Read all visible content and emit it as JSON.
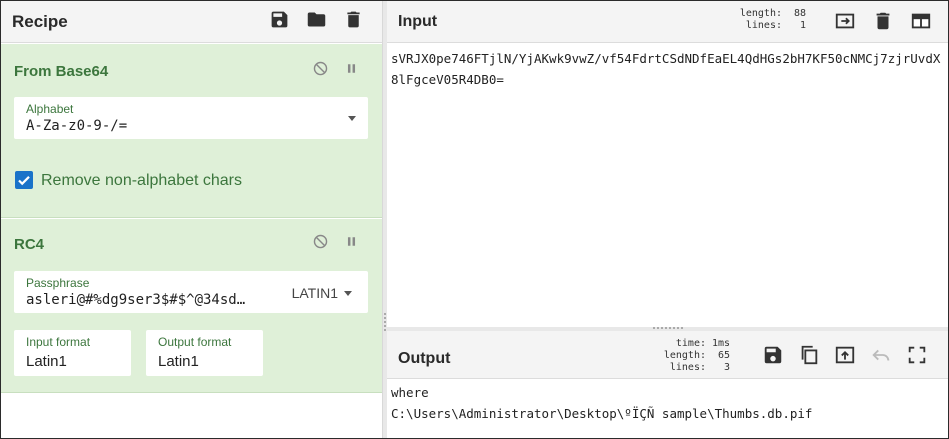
{
  "recipe": {
    "title": "Recipe",
    "icons": [
      "save-icon",
      "folder-icon",
      "trash-icon"
    ],
    "operations": [
      {
        "name": "From Base64",
        "alphabet_label": "Alphabet",
        "alphabet_value": "A-Za-z0-9-/=",
        "checkbox_label": "Remove non-alphabet chars",
        "checkbox_checked": true
      },
      {
        "name": "RC4",
        "passphrase_label": "Passphrase",
        "passphrase_value": "asleri@#%dg9ser3$#$^@34sd…",
        "passphrase_encoding": "LATIN1",
        "input_format_label": "Input format",
        "input_format_value": "Latin1",
        "output_format_label": "Output format",
        "output_format_value": "Latin1"
      }
    ]
  },
  "input": {
    "title": "Input",
    "stats": [
      {
        "key": "length:",
        "value": "88"
      },
      {
        "key": "lines:",
        "value": "1"
      }
    ],
    "icons": [
      "input-to-output-icon",
      "trash-icon",
      "layout-icon"
    ],
    "text": "sVRJX0pe746FTjlN/YjAKwk9vwZ/vf54FdrtCSdNDfEaEL4QdHGs2bH7KF50cNMCj7zjrUvdX8lFgceV05R4DB0="
  },
  "output": {
    "title": "Output",
    "stats": [
      {
        "key": "time:",
        "value": "1ms"
      },
      {
        "key": "length:",
        "value": "65"
      },
      {
        "key": "lines:",
        "value": "3"
      }
    ],
    "icons": [
      "save-icon",
      "copy-icon",
      "replace-input-icon",
      "undo-icon",
      "maximize-icon"
    ],
    "line1": "where",
    "line2": "C:\\Users\\Administrator\\Desktop\\ºÏÇÑ sample\\Thumbs.db.pif"
  },
  "colors": {
    "operation_bg": "#dff0d8",
    "operation_text": "#3c763d",
    "checkbox": "#1a73c9"
  }
}
